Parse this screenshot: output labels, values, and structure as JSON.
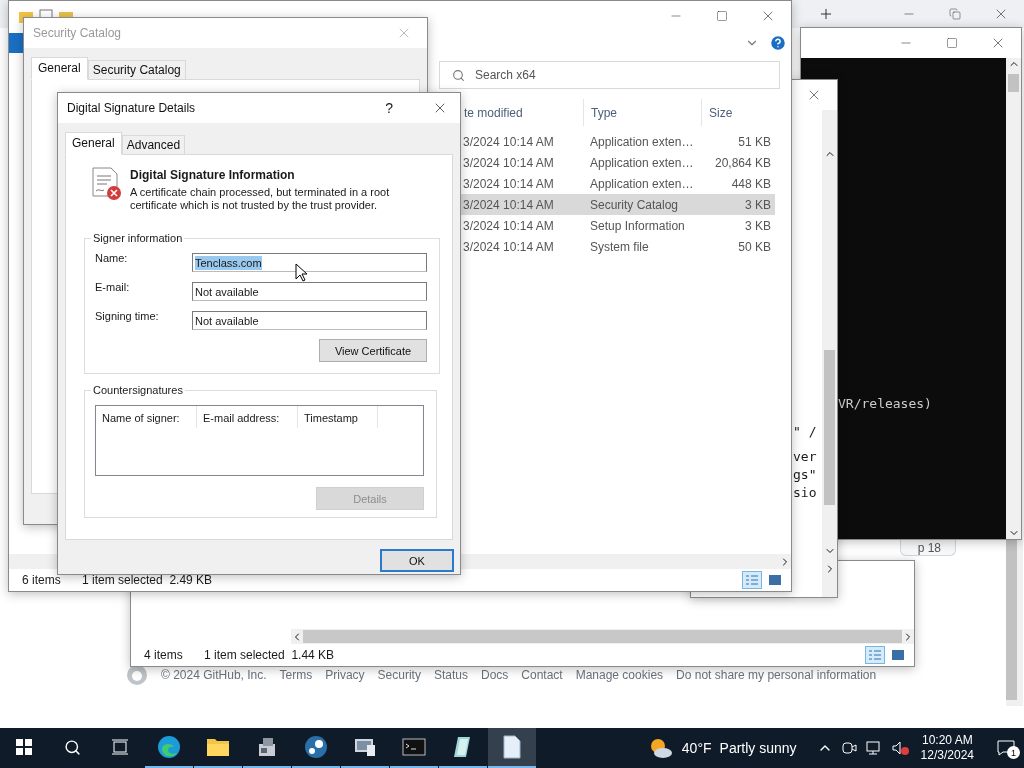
{
  "browser": {
    "footer": {
      "copyright": "© 2024 GitHub, Inc.",
      "links": [
        "Terms",
        "Privacy",
        "Security",
        "Status",
        "Docs",
        "Contact",
        "Manage cookies",
        "Do not share my personal information"
      ]
    },
    "page_button": "p 18"
  },
  "explorer_back": {
    "status_count": "4 items",
    "status_selection": "1 item selected  1.44 KB"
  },
  "terminal": {
    "lines": [
      "VR/releases)"
    ]
  },
  "editor": {
    "lines": [
      "\" /",
      "ver",
      "gs\"",
      "sio"
    ]
  },
  "explorer": {
    "search": {
      "placeholder": "Search x64"
    },
    "columns": [
      "te modified",
      "Type",
      "Size"
    ],
    "rows": [
      {
        "date": "3/2024 10:14 AM",
        "type": "Application exten…",
        "size": "51 KB",
        "selected": false
      },
      {
        "date": "3/2024 10:14 AM",
        "type": "Application exten…",
        "size": "20,864 KB",
        "selected": false
      },
      {
        "date": "3/2024 10:14 AM",
        "type": "Application exten…",
        "size": "448 KB",
        "selected": false
      },
      {
        "date": "3/2024 10:14 AM",
        "type": "Security Catalog",
        "size": "3 KB",
        "selected": true
      },
      {
        "date": "3/2024 10:14 AM",
        "type": "Setup Information",
        "size": "3 KB",
        "selected": false
      },
      {
        "date": "3/2024 10:14 AM",
        "type": "System file",
        "size": "50 KB",
        "selected": false
      }
    ],
    "status_count": "6 items",
    "status_selection": "1 item selected  2.49 KB"
  },
  "security_catalog": {
    "title": "Security Catalog",
    "tabs": [
      {
        "label": "General",
        "selected": true
      },
      {
        "label": "Security Catalog",
        "selected": false
      }
    ]
  },
  "signature_dialog": {
    "title": "Digital Signature Details",
    "help": "?",
    "tabs": [
      {
        "label": "General",
        "selected": true
      },
      {
        "label": "Advanced",
        "selected": false
      }
    ],
    "heading": "Digital Signature Information",
    "message": "A certificate chain processed, but terminated in a root certificate which is not trusted by the trust provider.",
    "signer_group": "Signer information",
    "fields": [
      {
        "label": "Name:",
        "value": "Tenclass.com",
        "selected": true
      },
      {
        "label": "E-mail:",
        "value": "Not available",
        "selected": false
      },
      {
        "label": "Signing time:",
        "value": "Not available",
        "selected": false
      }
    ],
    "view_certificate": "View Certificate",
    "countersignatures": {
      "title": "Countersignatures",
      "columns": [
        "Name of signer:",
        "E-mail address:",
        "Timestamp"
      ]
    },
    "details": {
      "label": "Details",
      "disabled": true
    },
    "ok": "OK"
  },
  "taskbar": {
    "apps": [
      {
        "kind": "edge",
        "open": true,
        "active": false
      },
      {
        "kind": "folder",
        "open": true,
        "active": false
      },
      {
        "kind": "installer",
        "open": true,
        "active": false
      },
      {
        "kind": "steam",
        "open": true,
        "active": false
      },
      {
        "kind": "monitor",
        "open": true,
        "active": false
      },
      {
        "kind": "console",
        "open": true,
        "active": false
      },
      {
        "kind": "glass",
        "open": true,
        "active": false
      },
      {
        "kind": "document",
        "open": true,
        "active": true
      }
    ],
    "weather": {
      "temp": "40°F",
      "condition": "Partly sunny"
    },
    "time": "10:20 AM",
    "date": "12/3/2024",
    "notifications": "1"
  }
}
